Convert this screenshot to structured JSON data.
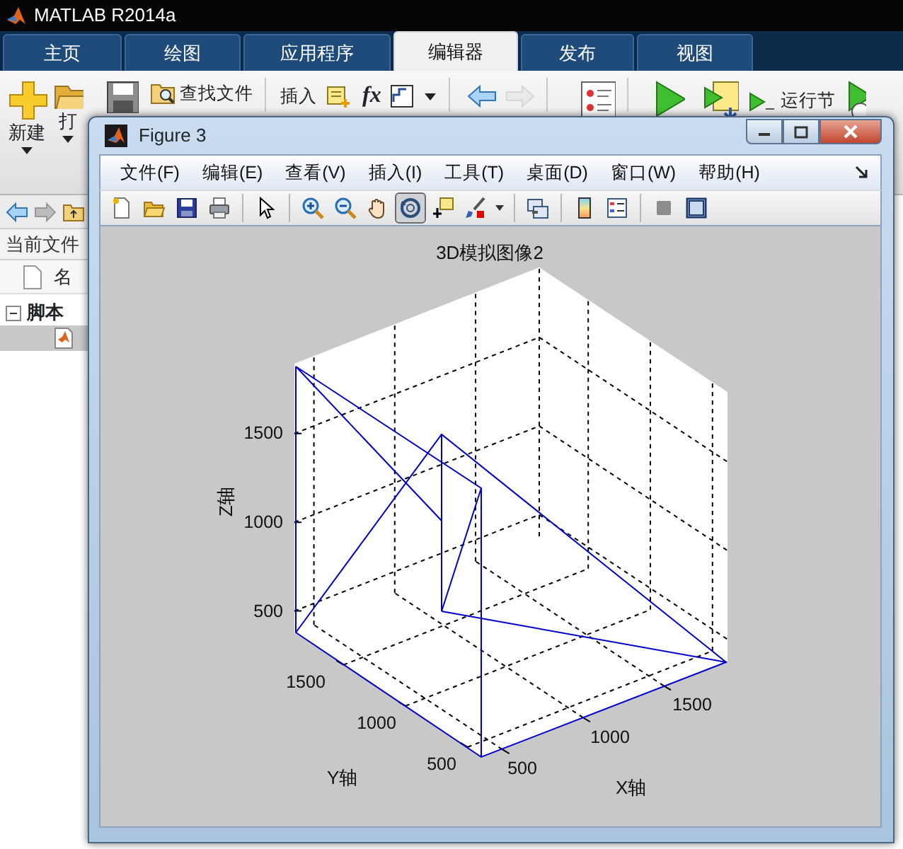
{
  "main_window": {
    "title": "MATLAB R2014a"
  },
  "tabs": [
    {
      "label": "主页",
      "selected": false
    },
    {
      "label": "绘图",
      "selected": false
    },
    {
      "label": "应用程序",
      "selected": false
    },
    {
      "label": "编辑器",
      "selected": true
    },
    {
      "label": "发布",
      "selected": false
    },
    {
      "label": "视图",
      "selected": false
    }
  ],
  "toolstrip": [
    {
      "kind": "new",
      "label": "新建",
      "dropdown": true
    },
    {
      "kind": "open",
      "label": "打",
      "dropdown": true
    },
    {
      "kind": "save"
    },
    {
      "kind": "find-files",
      "label": "查找文件"
    },
    {
      "kind": "insert",
      "label": "插入"
    },
    {
      "kind": "comment"
    },
    {
      "kind": "fx",
      "label": "fx"
    },
    {
      "kind": "fi"
    },
    {
      "kind": "menu-caret"
    },
    {
      "kind": "back",
      "disabled": false
    },
    {
      "kind": "forward",
      "disabled": true
    },
    {
      "kind": "breakpoints"
    },
    {
      "kind": "run"
    },
    {
      "kind": "run-advance"
    },
    {
      "kind": "run-section",
      "label": "运行节"
    },
    {
      "kind": "timer"
    }
  ],
  "current_folder": {
    "title": "当前文件",
    "column": "名",
    "groups": [
      {
        "label": "脚本",
        "expanded": true,
        "files": [
          {
            "selected": true
          }
        ]
      }
    ]
  },
  "figure": {
    "title": "Figure 3",
    "menus": [
      "文件(F)",
      "编辑(E)",
      "查看(V)",
      "插入(I)",
      "工具(T)",
      "桌面(D)",
      "窗口(W)",
      "帮助(H)"
    ],
    "toolbar": [
      {
        "kind": "new",
        "selected": false
      },
      {
        "kind": "open",
        "selected": false
      },
      {
        "kind": "save",
        "selected": false
      },
      {
        "kind": "print",
        "selected": false
      },
      {
        "kind": "separator"
      },
      {
        "kind": "pointer",
        "selected": false
      },
      {
        "kind": "separator"
      },
      {
        "kind": "zoom-in",
        "selected": false
      },
      {
        "kind": "zoom-out",
        "selected": false
      },
      {
        "kind": "pan",
        "selected": false
      },
      {
        "kind": "rotate",
        "selected": true
      },
      {
        "kind": "data-cursor",
        "selected": false
      },
      {
        "kind": "brush",
        "selected": false
      },
      {
        "kind": "dropdown"
      },
      {
        "kind": "separator"
      },
      {
        "kind": "link",
        "selected": false
      },
      {
        "kind": "separator"
      },
      {
        "kind": "colorbar",
        "selected": false
      },
      {
        "kind": "legend",
        "selected": false
      },
      {
        "kind": "separator"
      },
      {
        "kind": "hide-tools",
        "selected": false
      },
      {
        "kind": "show-tools",
        "selected": false
      }
    ],
    "plot": {
      "title": "3D模拟图像2",
      "xlabel": "X轴",
      "ylabel": "Y轴",
      "zlabel": "Z轴",
      "xticks": [
        "500",
        "1000",
        "1500"
      ],
      "yticks": [
        "1500",
        "1000",
        "500"
      ],
      "zticks": [
        "1500",
        "1000",
        "500"
      ]
    }
  }
}
